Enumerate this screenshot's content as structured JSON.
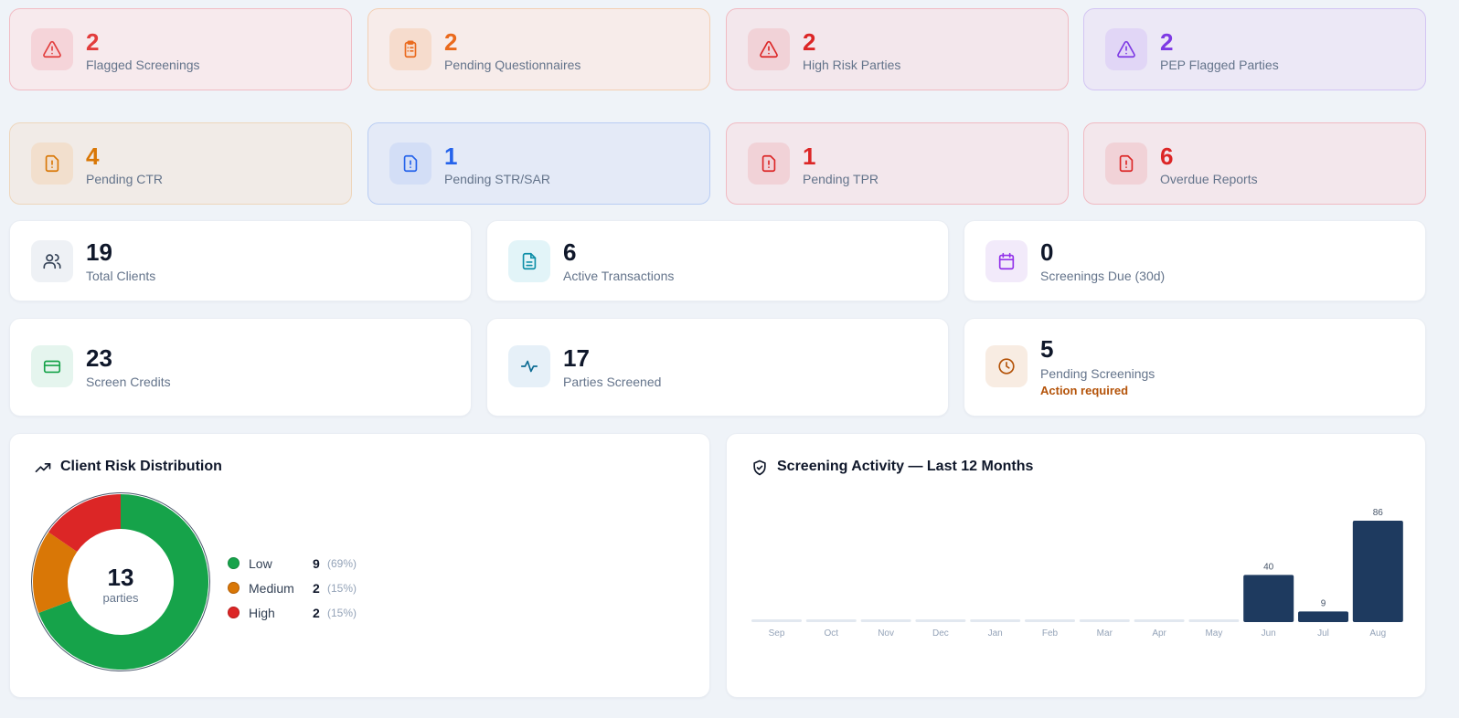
{
  "alerts_row1": [
    {
      "value": "2",
      "label": "Flagged Screenings",
      "icon": "alert-triangle-icon",
      "accent": "#e23d3d"
    },
    {
      "value": "2",
      "label": "Pending Questionnaires",
      "icon": "clipboard-list-icon",
      "accent": "#ea6a1d"
    },
    {
      "value": "2",
      "label": "High Risk Parties",
      "icon": "alert-triangle-icon",
      "accent": "#dc2626"
    },
    {
      "value": "2",
      "label": "PEP Flagged Parties",
      "icon": "alert-triangle-icon",
      "accent": "#7e3ae4"
    }
  ],
  "alerts_row2": [
    {
      "value": "4",
      "label": "Pending CTR",
      "icon": "file-alert-icon",
      "accent": "#d97706"
    },
    {
      "value": "1",
      "label": "Pending STR/SAR",
      "icon": "file-alert-icon",
      "accent": "#2563eb"
    },
    {
      "value": "1",
      "label": "Pending TPR",
      "icon": "file-alert-icon",
      "accent": "#dc2626"
    },
    {
      "value": "6",
      "label": "Overdue Reports",
      "icon": "file-alert-icon",
      "accent": "#dc2626"
    }
  ],
  "stats_row1": [
    {
      "value": "19",
      "label": "Total Clients",
      "icon": "users-icon"
    },
    {
      "value": "6",
      "label": "Active Transactions",
      "icon": "document-icon"
    },
    {
      "value": "0",
      "label": "Screenings Due (30d)",
      "icon": "calendar-icon"
    }
  ],
  "stats_row2": [
    {
      "value": "23",
      "label": "Screen Credits",
      "icon": "credit-card-icon"
    },
    {
      "value": "17",
      "label": "Parties Screened",
      "icon": "activity-icon"
    },
    {
      "value": "5",
      "label": "Pending Screenings",
      "sub": "Action required",
      "icon": "clock-icon"
    }
  ],
  "risk_panel": {
    "title": "Client Risk Distribution",
    "icon": "trending-up-icon",
    "center_value": "13",
    "center_label": "parties",
    "legend": [
      {
        "name": "Low",
        "count": "9",
        "pct": "(69%)",
        "color": "#16a34a"
      },
      {
        "name": "Medium",
        "count": "2",
        "pct": "(15%)",
        "color": "#d97706"
      },
      {
        "name": "High",
        "count": "2",
        "pct": "(15%)",
        "color": "#dc2626"
      }
    ]
  },
  "activity_panel": {
    "title": "Screening Activity — Last 12 Months",
    "icon": "shield-check-icon"
  },
  "chart_data": [
    {
      "type": "pie",
      "categories": [
        "Low",
        "Medium",
        "High"
      ],
      "values": [
        9,
        2,
        2
      ],
      "colors": [
        "#16a34a",
        "#d97706",
        "#dc2626"
      ],
      "title": "Client Risk Distribution"
    },
    {
      "type": "bar",
      "categories": [
        "Sep",
        "Oct",
        "Nov",
        "Dec",
        "Jan",
        "Feb",
        "Mar",
        "Apr",
        "May",
        "Jun",
        "Jul",
        "Aug"
      ],
      "values": [
        0,
        0,
        0,
        0,
        0,
        0,
        0,
        0,
        0,
        40,
        9,
        86
      ],
      "data_labels": [
        "",
        "",
        "",
        "",
        "",
        "",
        "",
        "",
        "",
        "40",
        "9",
        "86"
      ],
      "bar_color": "#1e3a5f",
      "title": "Screening Activity — Last 12 Months",
      "ylim": [
        0,
        86
      ]
    }
  ]
}
